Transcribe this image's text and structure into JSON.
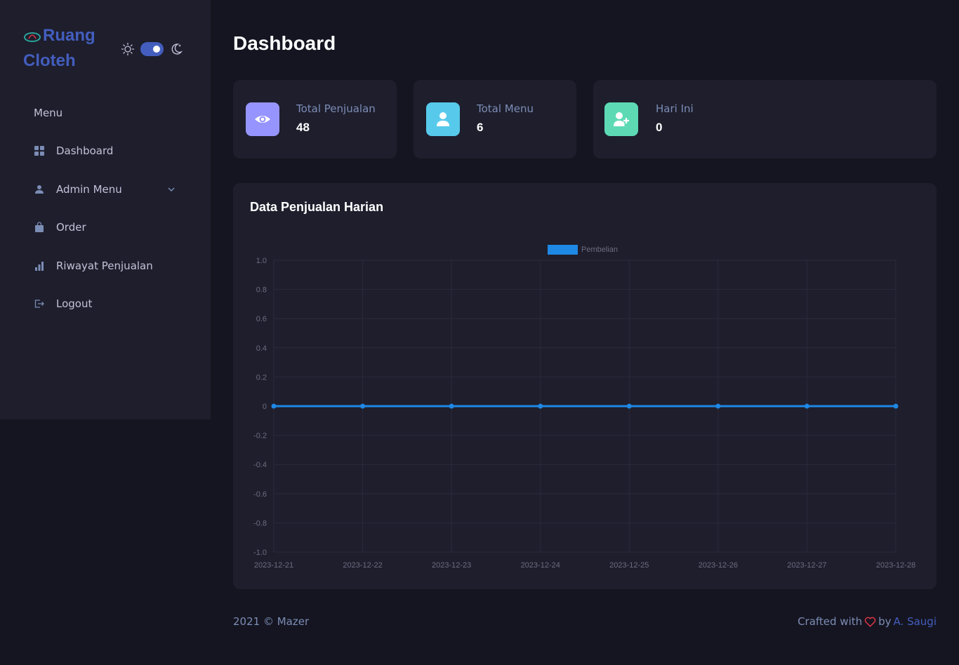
{
  "sidebar": {
    "logo_text": "Ruang Cloteh",
    "menu_title": "Menu",
    "items": [
      {
        "label": "Dashboard",
        "icon": "grid-icon"
      },
      {
        "label": "Admin Menu",
        "icon": "person-icon"
      },
      {
        "label": "Order",
        "icon": "bag-icon"
      },
      {
        "label": "Riwayat Penjualan",
        "icon": "bar-chart-icon"
      },
      {
        "label": "Logout",
        "icon": "logout-icon"
      }
    ]
  },
  "header": {
    "title": "Dashboard"
  },
  "stats": [
    {
      "label": "Total Penjualan",
      "value": "48",
      "icon": "eye-icon",
      "color": "#9694ff"
    },
    {
      "label": "Total Menu",
      "value": "6",
      "icon": "user-icon",
      "color": "#57caeb"
    },
    {
      "label": "Hari Ini",
      "value": "0",
      "icon": "user-plus-icon",
      "color": "#5ddab4"
    }
  ],
  "chart_card": {
    "title": "Data Penjualan Harian"
  },
  "chart_data": {
    "type": "line",
    "x": [
      "2023-12-21",
      "2023-12-22",
      "2023-12-23",
      "2023-12-24",
      "2023-12-25",
      "2023-12-26",
      "2023-12-27",
      "2023-12-28"
    ],
    "series": [
      {
        "name": "Pembelian",
        "values": [
          0,
          0,
          0,
          0,
          0,
          0,
          0,
          0
        ],
        "color": "#1e88e5"
      }
    ],
    "ylim": [
      -1.0,
      1.0
    ],
    "yticks": [
      "1.0",
      "0.8",
      "0.6",
      "0.4",
      "0.2",
      "0",
      "-0.2",
      "-0.4",
      "-0.6",
      "-0.8",
      "-1.0"
    ],
    "grid": true,
    "legend": "top"
  },
  "footer": {
    "left": "2021 © Mazer",
    "crafted": "Crafted with",
    "by": "by",
    "author": "A. Saugi"
  },
  "colors": {
    "accent": "#435ebe",
    "heart": "#dc3545"
  }
}
